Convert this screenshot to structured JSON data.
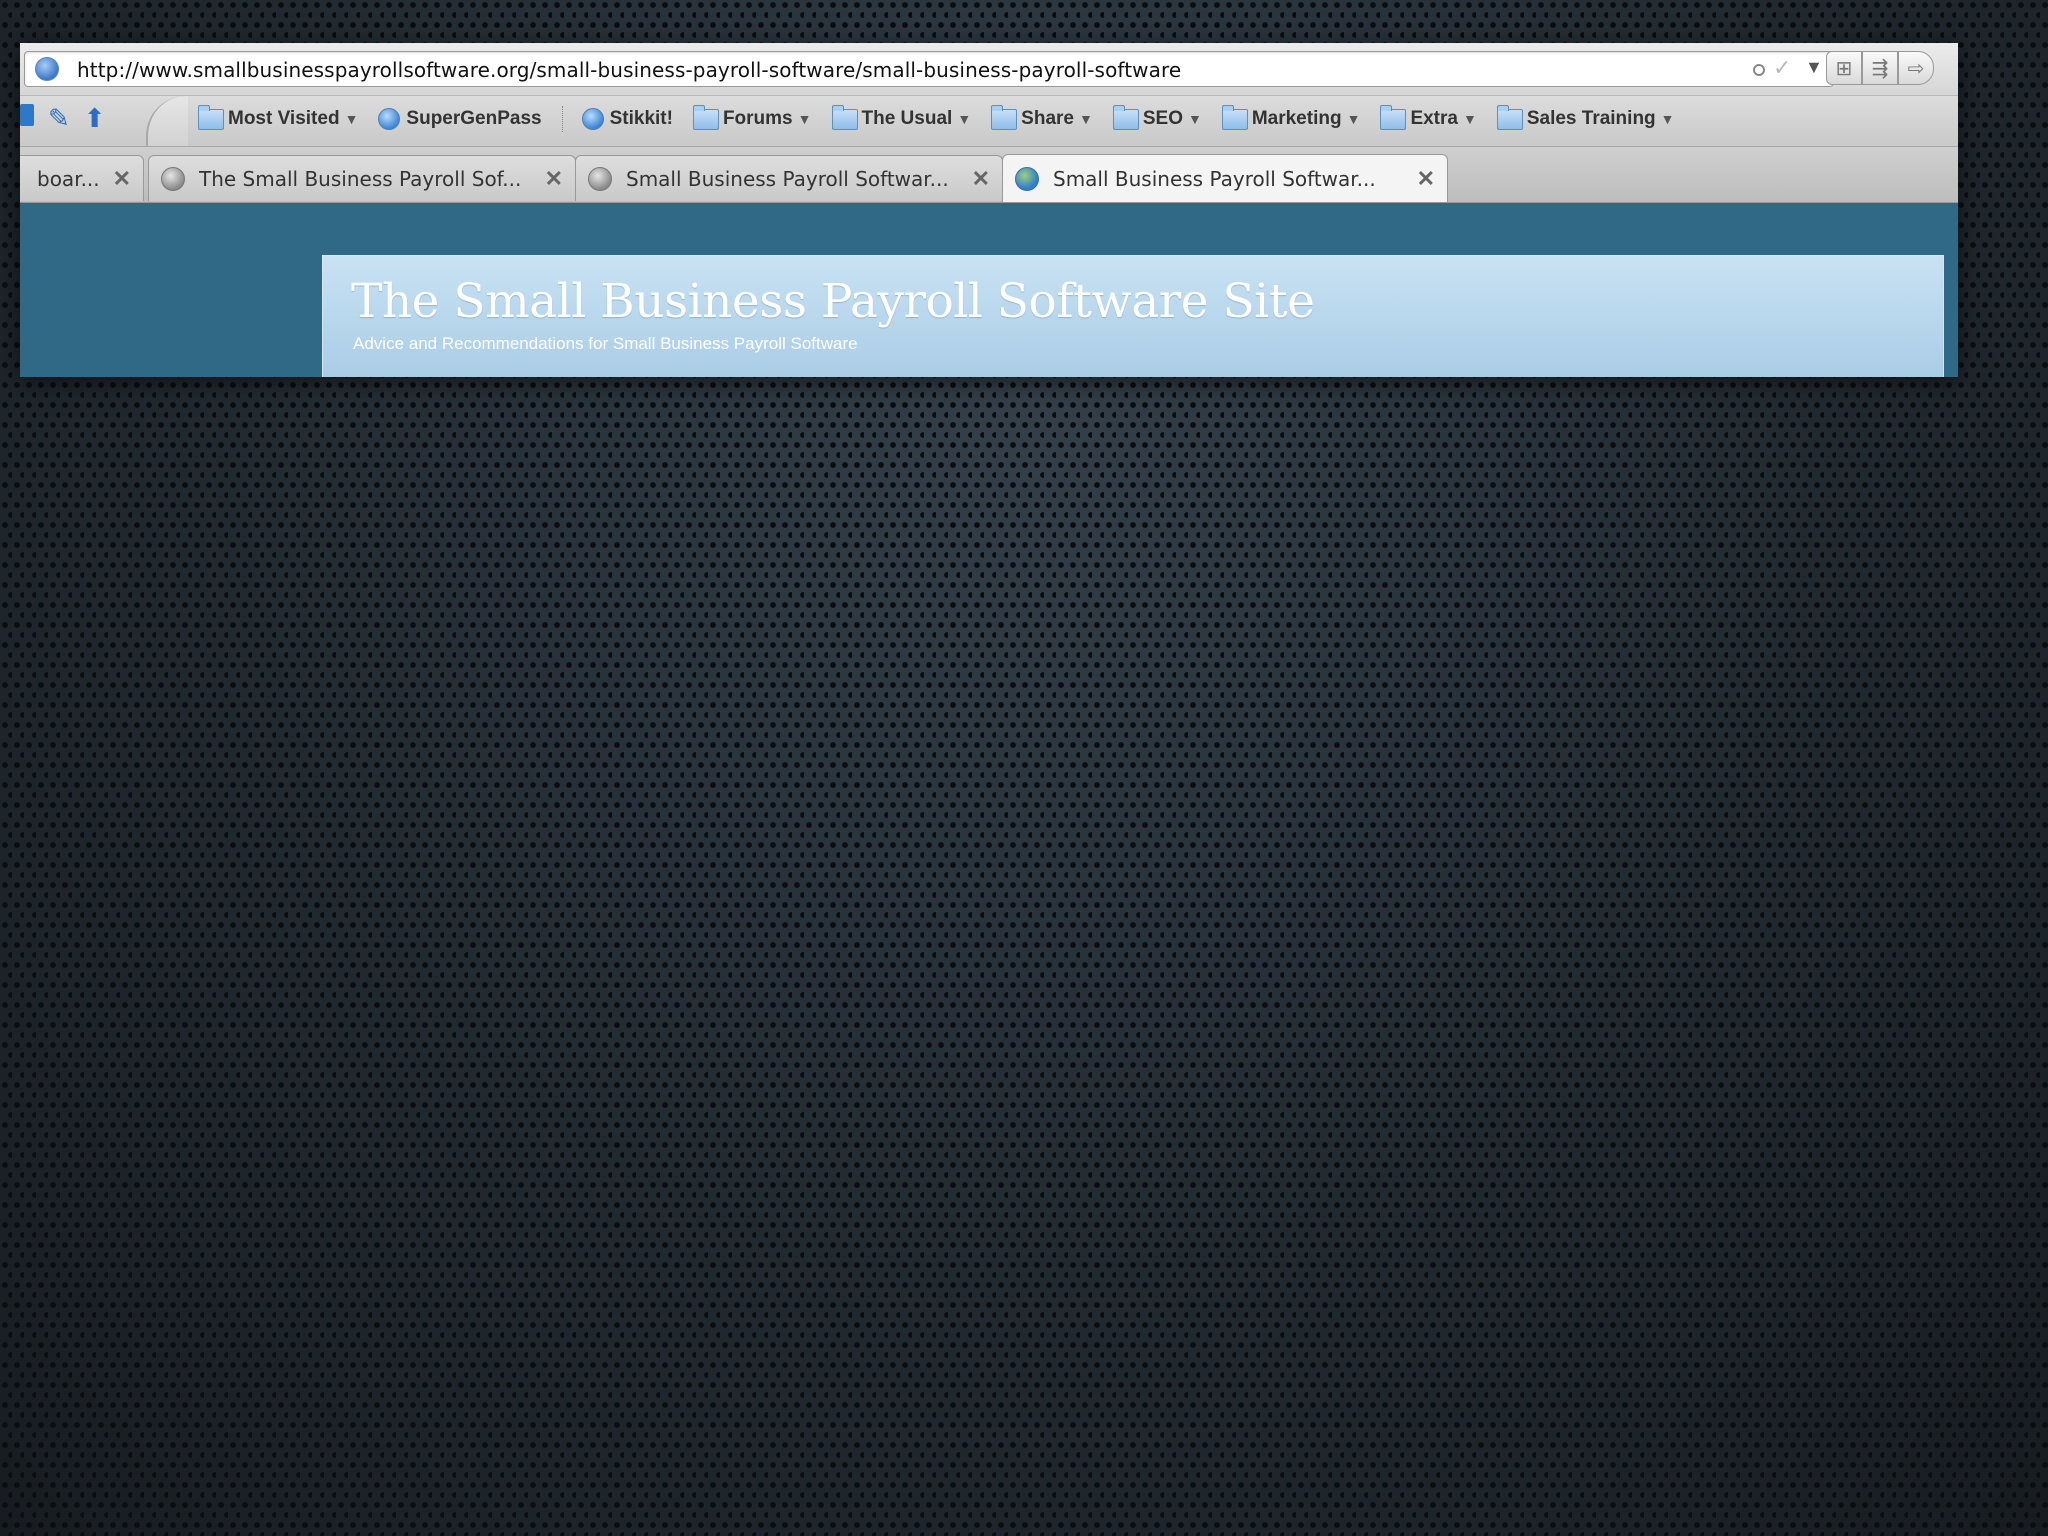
{
  "browser": {
    "url": "http://www.smallbusinesspayrollsoftware.org/small-business-payroll-software/small-business-payroll-software",
    "bookmarks": [
      {
        "label": "Most Visited",
        "icon": "folder-icon",
        "dropdown": true
      },
      {
        "label": "SuperGenPass",
        "icon": "globe-icon",
        "dropdown": false
      },
      {
        "label": "Stikkit!",
        "icon": "globe-icon",
        "dropdown": false
      },
      {
        "label": "Forums",
        "icon": "folder-icon",
        "dropdown": true
      },
      {
        "label": "The Usual",
        "icon": "folder-icon",
        "dropdown": true
      },
      {
        "label": "Share",
        "icon": "folder-icon",
        "dropdown": true
      },
      {
        "label": "SEO",
        "icon": "folder-icon",
        "dropdown": true
      },
      {
        "label": "Marketing",
        "icon": "folder-icon",
        "dropdown": true
      },
      {
        "label": "Extra",
        "icon": "folder-icon",
        "dropdown": true
      },
      {
        "label": "Sales Training",
        "icon": "folder-icon",
        "dropdown": true
      }
    ],
    "tabs": [
      {
        "title": "boar...",
        "active": false
      },
      {
        "title": "The Small Business Payroll Sof...",
        "active": false
      },
      {
        "title": "Small Business Payroll Softwar...",
        "active": false
      },
      {
        "title": "Small Business Payroll Softwar...",
        "active": true
      }
    ],
    "tab_close_glyph": "✕"
  },
  "site": {
    "title": "The Small Business Payroll Software Site",
    "subtitle": "Advice and Recommendations for Small Business Payroll Software"
  },
  "colors": {
    "page_background": "#2f6985",
    "banner": "#b9d8ee"
  }
}
